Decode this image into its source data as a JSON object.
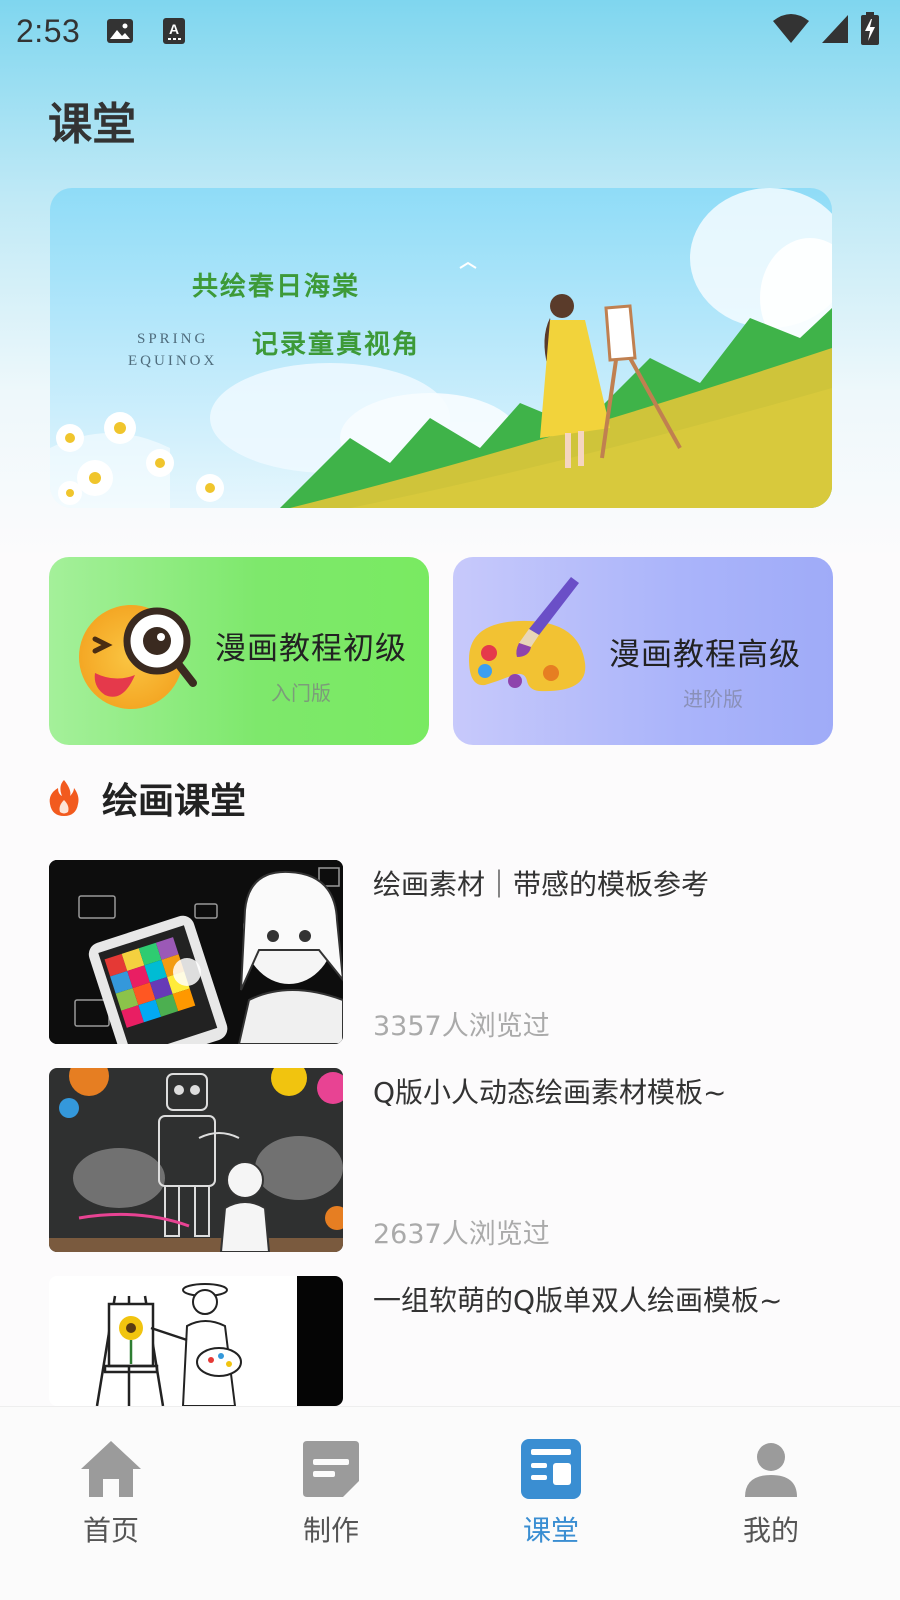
{
  "status_bar": {
    "time": "2:53"
  },
  "page": {
    "title": "课堂"
  },
  "banner": {
    "line1": "共绘春日海棠",
    "line2": "记录童真视角",
    "en_line1": "SPRING",
    "en_line2": "EQUINOX"
  },
  "cards": [
    {
      "title": "漫画教程初级",
      "subtitle": "入门版",
      "icon": "magnifier-emoji-icon",
      "color": "#7ee86c"
    },
    {
      "title": "漫画教程高级",
      "subtitle": "进阶版",
      "icon": "paint-palette-icon",
      "color": "#aab4fa"
    }
  ],
  "section": {
    "title": "绘画课堂",
    "icon": "fire-icon",
    "icon_color": "#f25a1e"
  },
  "articles": [
    {
      "title": "绘画素材｜带感的模板参考",
      "views": "3357人浏览过"
    },
    {
      "title": "Q版小人动态绘画素材模板~",
      "views": "2637人浏览过"
    },
    {
      "title": "一组软萌的Q版单双人绘画模板~",
      "views": ""
    }
  ],
  "nav": {
    "active_color": "#3a8ed2",
    "items": [
      {
        "label": "首页",
        "icon": "home-icon"
      },
      {
        "label": "制作",
        "icon": "create-icon"
      },
      {
        "label": "课堂",
        "icon": "classroom-icon"
      },
      {
        "label": "我的",
        "icon": "profile-icon"
      }
    ]
  }
}
